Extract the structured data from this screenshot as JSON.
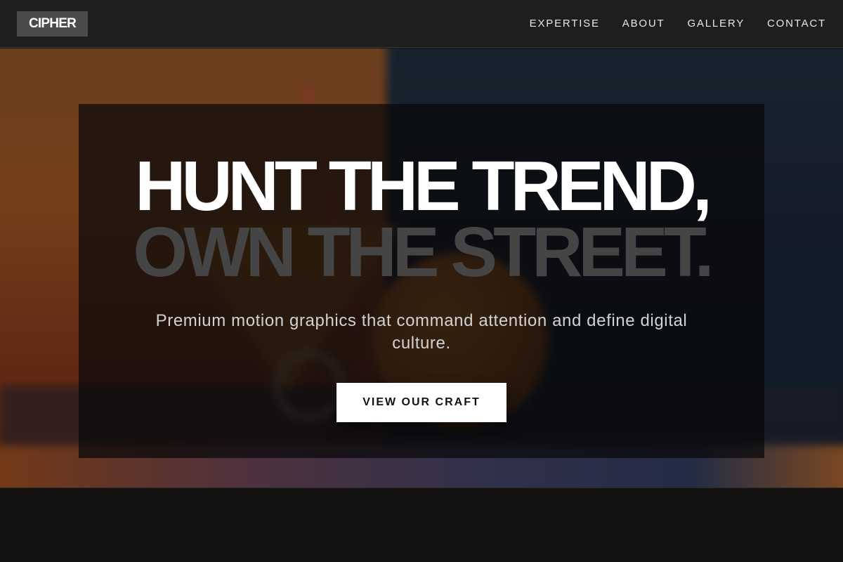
{
  "brand": {
    "logo_text": "CIPHER"
  },
  "nav": {
    "items": [
      {
        "label": "EXPERTISE"
      },
      {
        "label": "ABOUT"
      },
      {
        "label": "GALLERY"
      },
      {
        "label": "CONTACT"
      }
    ]
  },
  "hero": {
    "headline_line1": "HUNT THE TREND,",
    "headline_line2": "OWN THE STREET.",
    "subtitle": "Premium motion graphics that command attention and define digital culture.",
    "cta_label": "VIEW OUR CRAFT",
    "background_description": "blurred photo of abstract 3D objects (sphere, cone, ring) on orange and navy backdrop"
  },
  "colors": {
    "nav_bg": "#1f1e1d",
    "logo_bg": "#4a4a4a",
    "headline_primary": "#ffffff",
    "headline_secondary": "#454545",
    "cta_bg": "#ffffff",
    "cta_text": "#111111"
  }
}
